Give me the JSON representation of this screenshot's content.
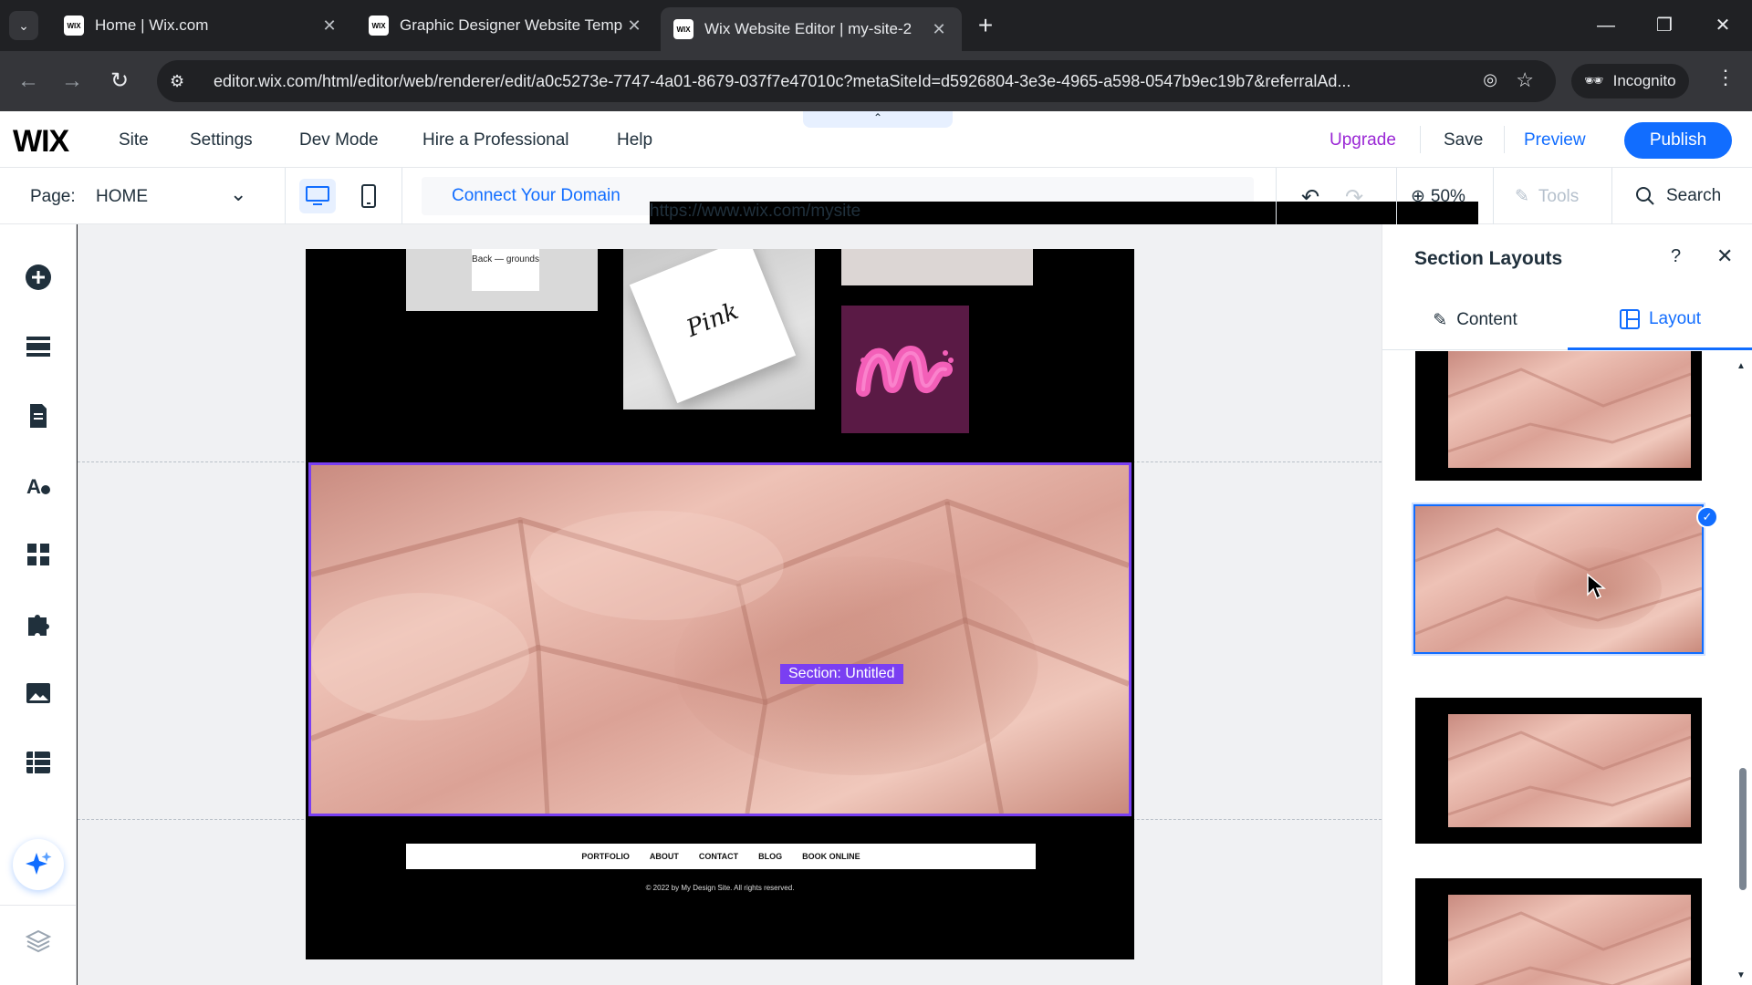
{
  "browser": {
    "tabs": [
      {
        "title": "Home | Wix.com",
        "favicon": "WIX"
      },
      {
        "title": "Graphic Designer Website Temp",
        "favicon": "WIX"
      },
      {
        "title": "Wix Website Editor | my-site-2",
        "favicon": "WIX"
      }
    ],
    "active_tab": 2,
    "url": "editor.wix.com/html/editor/web/renderer/edit/a0c5273e-7747-4a01-8679-037f7e47010c?metaSiteId=d5926804-3e3e-4965-a598-0547b9ec19b7&referralAd...",
    "incognito_label": "Incognito"
  },
  "topbar": {
    "logo": "WIX",
    "menu": [
      "Site",
      "Settings",
      "Dev Mode",
      "Hire a Professional",
      "Help"
    ],
    "upgrade": "Upgrade",
    "save": "Save",
    "preview": "Preview",
    "publish": "Publish"
  },
  "pagebar": {
    "page_label": "Page:",
    "page_value": "HOME",
    "site_url": "https://www.wix.com/mysite",
    "connect_domain": "Connect Your Domain",
    "zoom": "50%",
    "tools": "Tools",
    "search": "Search"
  },
  "canvas": {
    "section_label": "Section: Untitled",
    "card1_text": "Back — grounds",
    "card2_text": "Pink",
    "logo_letter": "m",
    "footer_links": [
      "PORTFOLIO",
      "ABOUT",
      "CONTACT",
      "BLOG",
      "BOOK ONLINE"
    ],
    "copyright": "© 2022 by My Design Site. All rights reserved."
  },
  "panel": {
    "title": "Section Layouts",
    "help": "?",
    "tabs": [
      {
        "label": "Content",
        "icon": "pencil-icon"
      },
      {
        "label": "Layout",
        "icon": "layout-icon"
      }
    ],
    "active_tab": "Layout",
    "selected_layout": 2
  },
  "colors": {
    "wix_blue": "#116dff",
    "upgrade_purple": "#9a27d5",
    "selection_purple": "#7a3ff2",
    "fabric_pink": "#e8b4a8"
  }
}
